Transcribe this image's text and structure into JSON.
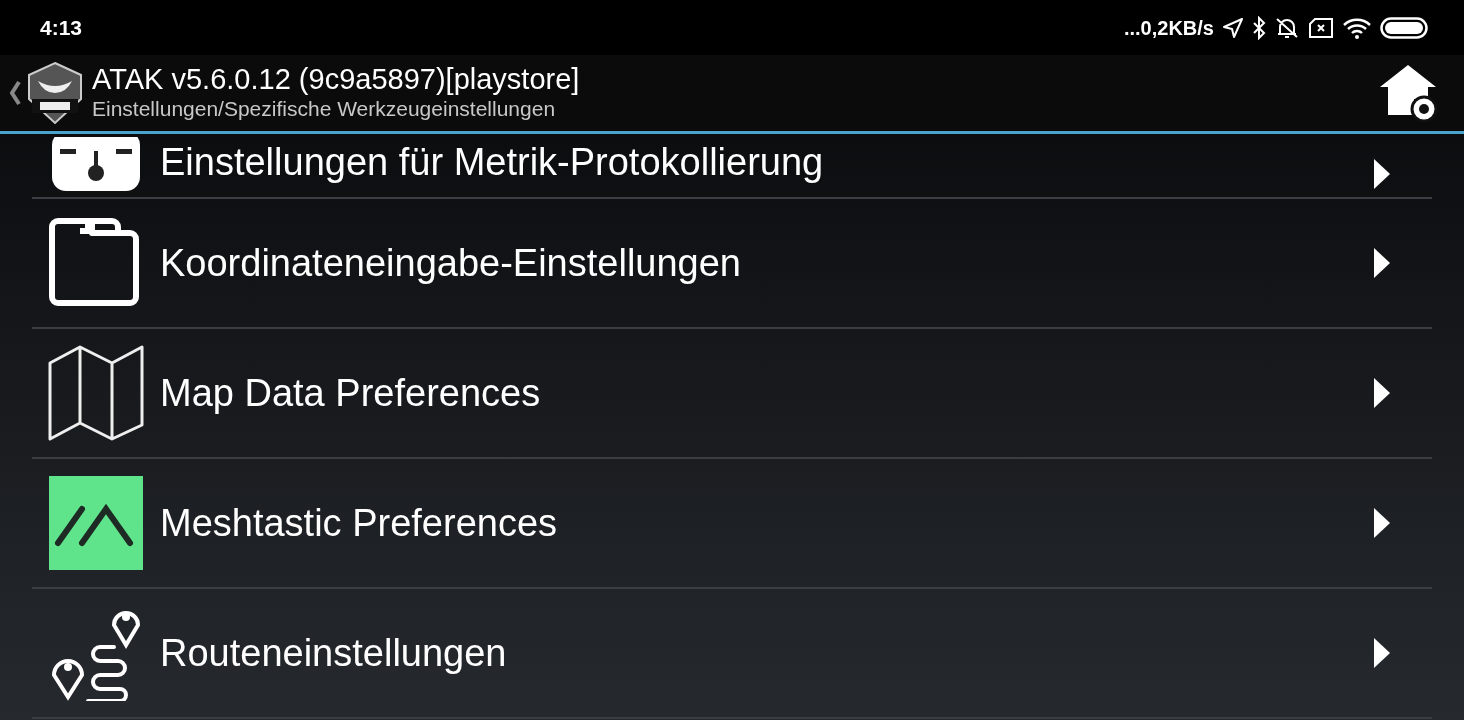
{
  "status_bar": {
    "time": "4:13",
    "network_speed": "...0,2KB/s"
  },
  "header": {
    "title": "ATAK v5.6.0.12 (9c9a5897)[playstore]",
    "subtitle": "Einstellungen/Spezifische Werkzeugeinstellungen"
  },
  "items": [
    {
      "label": "Einstellungen für Metrik-Protokollierung",
      "kind": "gauge"
    },
    {
      "label": "Koordinateneingabe-Einstellungen",
      "kind": "folder"
    },
    {
      "label": "Map Data Preferences",
      "kind": "map"
    },
    {
      "label": "Meshtastic Preferences",
      "kind": "mesh"
    },
    {
      "label": "Routeneinstellungen",
      "kind": "route"
    }
  ]
}
